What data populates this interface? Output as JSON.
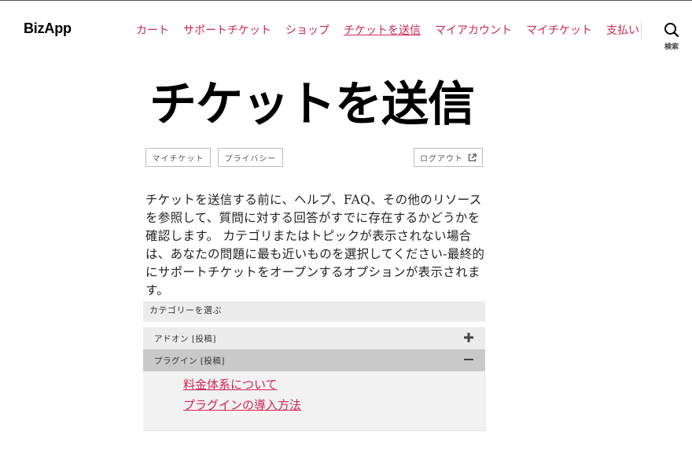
{
  "header": {
    "site_title": "BizApp",
    "nav": [
      {
        "label": "カート"
      },
      {
        "label": "サポートチケット"
      },
      {
        "label": "ショップ"
      },
      {
        "label": "チケットを送信"
      },
      {
        "label": "マイアカウント"
      },
      {
        "label": "マイチケット"
      },
      {
        "label": "支払い"
      }
    ],
    "current_nav": "チケットを送信",
    "search_label": "検索"
  },
  "page": {
    "title": "チケットを送信",
    "buttons": {
      "my_tickets": "マイチケット",
      "privacy": "プライバシー",
      "logout": "ログアウト"
    },
    "intro": "チケットを送信する前に、ヘルプ、FAQ、その他のリソースを参照して、質問に対する回答がすでに存在するかどうかを確認します。 カテゴリまたはトピックが表示されない場合は、あなたの問題に最も近いものを選択してください-最終的にサポートチケットをオープンするオプションが表示されます。"
  },
  "category": {
    "header": "カテゴリーを選ぶ",
    "items": [
      {
        "label": "アドオン [投稿]",
        "state": "collapsed",
        "icon": "plus-icon"
      },
      {
        "label": "プラグイン [投稿]",
        "state": "expanded",
        "icon": "minus-icon",
        "links": [
          "料金体系について",
          "プラグインの導入方法"
        ]
      }
    ]
  },
  "colors": {
    "accent": "#cd2653",
    "panel_bg": "#ececec",
    "active_bg": "#c9c9c9"
  }
}
